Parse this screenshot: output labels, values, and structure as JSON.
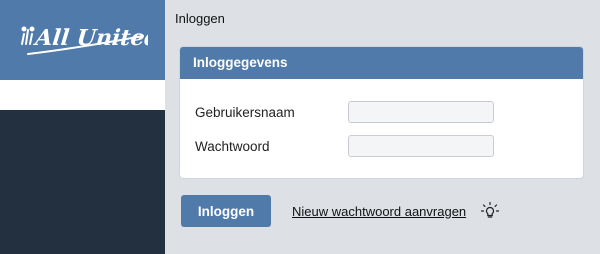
{
  "brand": {
    "logo_text": "All United",
    "logo_color": "#ffffff",
    "band_color": "#4f7aaa",
    "sidebar_color": "#223040"
  },
  "page": {
    "title": "Inloggen"
  },
  "panel": {
    "title": "Inloggegevens",
    "username_label": "Gebruikersnaam",
    "username_value": "",
    "password_label": "Wachtwoord",
    "password_value": ""
  },
  "actions": {
    "login_label": "Inloggen",
    "reset_password_label": "Nieuw wachtwoord aanvragen",
    "hint_icon": "lightbulb-icon"
  },
  "colors": {
    "accent": "#4f7aaa",
    "background": "#dde1e6"
  }
}
